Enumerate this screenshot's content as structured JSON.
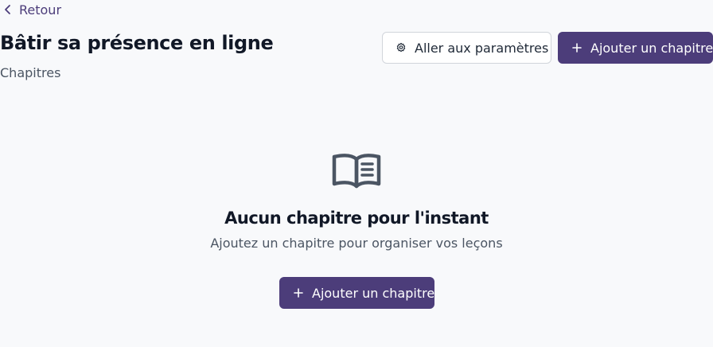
{
  "nav": {
    "back_label": "Retour",
    "back_icon": "chevron-left-icon"
  },
  "header": {
    "title": "Bâtir sa présence en ligne",
    "subtitle": "Chapitres",
    "settings_button_label": "Aller aux paramètres",
    "settings_icon": "gear-icon",
    "add_chapter_button_label": "Ajouter un chapitre",
    "add_icon": "plus-icon"
  },
  "empty_state": {
    "icon": "open-book-icon",
    "title": "Aucun chapitre pour l'instant",
    "description": "Ajoutez un chapitre pour organiser vos leçons",
    "add_chapter_button_label": "Ajouter un chapitre"
  },
  "colors": {
    "background": "#f8f9fb",
    "primary": "#4c3d7a",
    "text": "#111827",
    "muted_text": "#4b5563",
    "border": "#d1d5db"
  }
}
